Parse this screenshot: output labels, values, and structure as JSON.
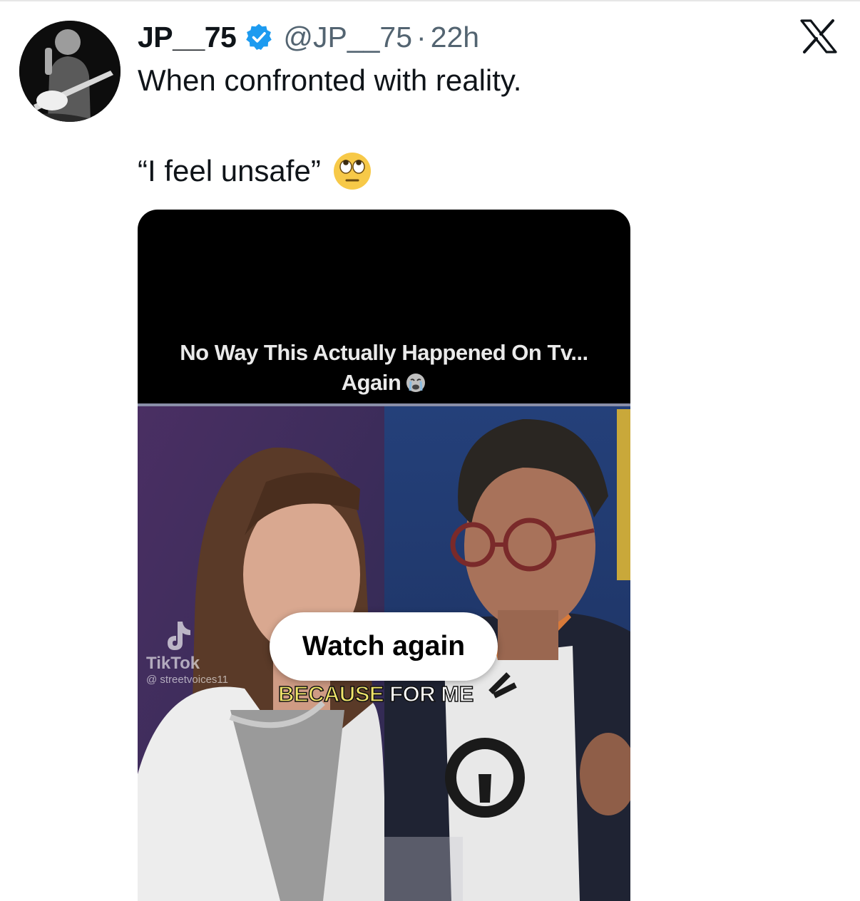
{
  "tweet": {
    "display_name": "JP__75",
    "handle": "@JP__75",
    "separator": "·",
    "time": "22h",
    "text_line1": "When confronted with reality.",
    "text_line2": "“I feel unsafe”",
    "emoji_icon": "face-with-rolling-eyes"
  },
  "platform_icon": "x-logo",
  "verified_icon": "verified-badge",
  "colors": {
    "verified": "#1d9bf0",
    "secondary_text": "#536471",
    "subtitle_yellow": "#f0e46a"
  },
  "media": {
    "caption_line1": "No Way This Actually Happened On Tv...",
    "caption_line2": "Again",
    "caption_emoji": "loudly-crying-face",
    "watermark_app": "TikTok",
    "watermark_user": "@ streetvoices11",
    "subtitle_highlight": "BECAUSE",
    "subtitle_rest": " FOR ME",
    "watch_again_label": "Watch again"
  }
}
